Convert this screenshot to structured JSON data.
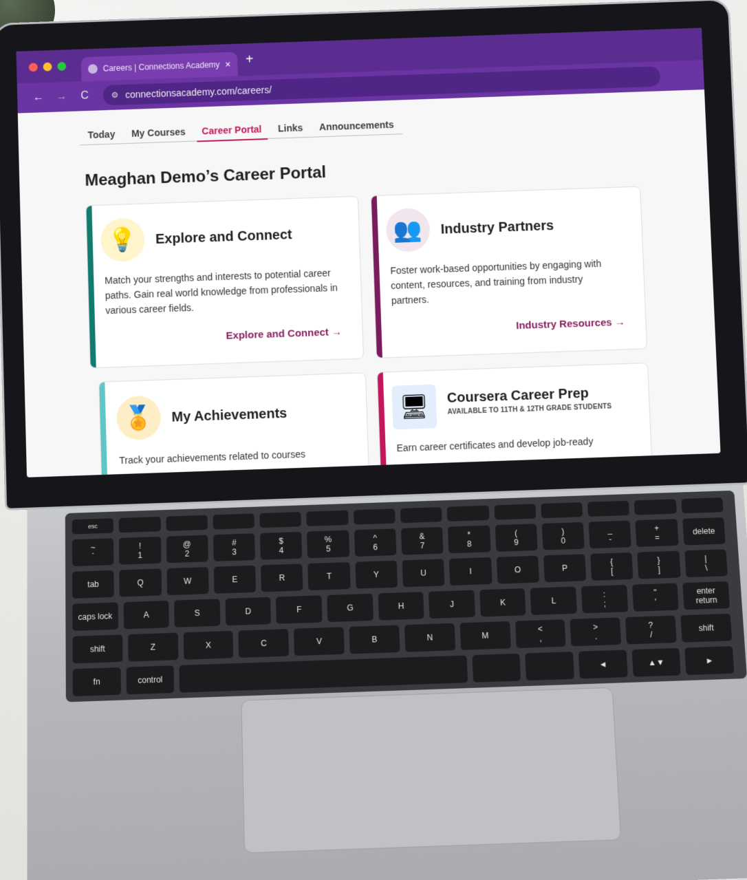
{
  "browser": {
    "tab_title": "Careers | Connections Academy",
    "tab_close": "×",
    "new_tab": "+",
    "back": "←",
    "forward": "→",
    "reload": "C",
    "url": "connectionsacademy.com/careers/"
  },
  "nav": {
    "tabs": [
      {
        "label": "Today"
      },
      {
        "label": "My Courses"
      },
      {
        "label": "Career Portal",
        "active": true
      },
      {
        "label": "Links"
      },
      {
        "label": "Announcements"
      }
    ]
  },
  "page_title": "Meaghan Demo’s Career Portal",
  "cards": [
    {
      "title": "Explore and Connect",
      "description": "Match your strengths and interests to potential career paths. Gain real world knowledge from professionals in various career fields.",
      "link": "Explore and Connect →",
      "accent": "#137a6e",
      "icon": "lightbulb-icon"
    },
    {
      "title": "Industry Partners",
      "description": "Foster work-based opportunities by engaging with content, resources, and training from industry partners.",
      "link": "Industry Resources →",
      "accent": "#7a1b5e",
      "icon": "people-network-icon"
    },
    {
      "title": "My Achievements",
      "description": "Track your achievements related to courses",
      "accent": "#5fc5c8",
      "icon": "medal-icon"
    },
    {
      "title": "Coursera Career Prep",
      "subtitle": "AVAILABLE TO 11TH & 12TH GRADE STUDENTS",
      "description": "Earn career certificates and develop job-ready",
      "accent": "#c2185b",
      "icon": "presentation-icon"
    }
  ],
  "keyboard": {
    "rows": [
      [
        "esc",
        "",
        "",
        "",
        "",
        "",
        "",
        "",
        "",
        "",
        "",
        "",
        "",
        ""
      ],
      [
        "~\n`",
        "!\n1",
        "@\n2",
        "#\n3",
        "$\n4",
        "%\n5",
        "^\n6",
        "&\n7",
        "*\n8",
        "(\n9",
        ")\n0",
        "_\n-",
        "+\n=",
        "delete"
      ],
      [
        "tab",
        "Q",
        "W",
        "E",
        "R",
        "T",
        "Y",
        "U",
        "I",
        "O",
        "P",
        "{\n[",
        "}\n]",
        "|\n\\"
      ],
      [
        "caps lock",
        "A",
        "S",
        "D",
        "F",
        "G",
        "H",
        "J",
        "K",
        "L",
        ":\n;",
        "\"\n'",
        "enter\nreturn"
      ],
      [
        "shift",
        "Z",
        "X",
        "C",
        "V",
        "B",
        "N",
        "M",
        "<\n,",
        ">\n.",
        "?\n/",
        "shift"
      ],
      [
        "fn",
        "control",
        "",
        "",
        "",
        "◄",
        "▲▼",
        "►"
      ]
    ]
  },
  "colors": {
    "browser_chrome": "#5c2d91",
    "active_tab": "#c2185b",
    "link": "#8a1f5e"
  }
}
